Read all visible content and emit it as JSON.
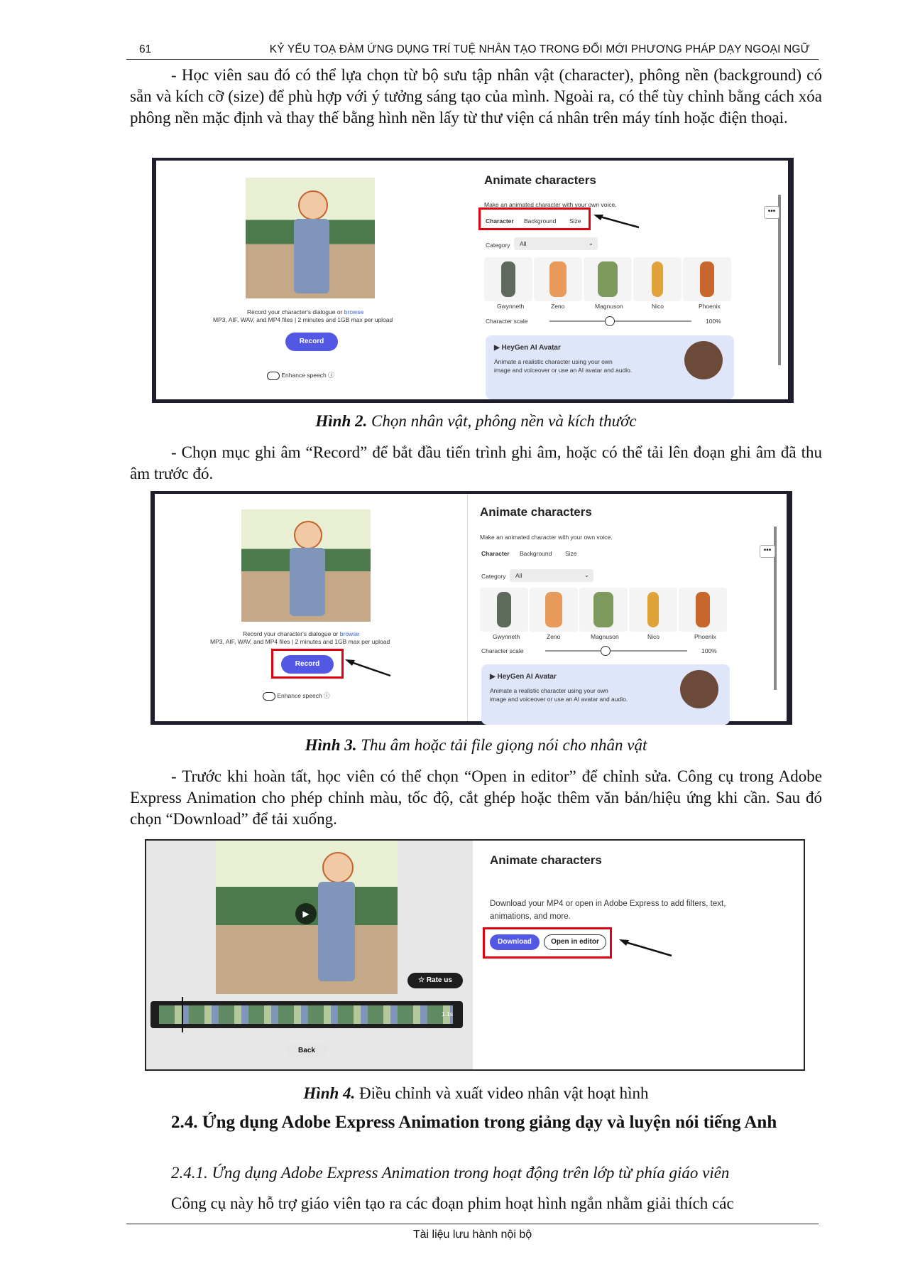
{
  "header": {
    "page_number": "61",
    "title": "KỶ YẾU TOẠ ĐÀM ỨNG DỤNG TRÍ TUỆ NHÂN TẠO TRONG ĐỔI MỚI PHƯƠNG PHÁP DẠY NGOẠI NGỮ"
  },
  "paragraphs": {
    "p1": "- Học viên sau đó có thể lựa chọn từ bộ sưu tập nhân vật (character), phông nền (background) có sẵn và kích cỡ (size) để phù hợp với ý tưởng sáng tạo của mình. Ngoài ra, có thể tùy chỉnh bằng cách xóa phông nền mặc định và thay thế bằng hình nền lấy từ thư viện cá nhân trên máy tính hoặc điện thoại.",
    "p2": "- Chọn mục ghi âm “Record” để bắt đầu tiến trình ghi âm, hoặc có thể tải lên đoạn ghi âm đã thu âm trước đó.",
    "p3": "- Trước khi hoàn tất, học viên có thể chọn “Open in editor” để chỉnh sửa. Công cụ trong Adobe Express Animation cho phép chỉnh màu, tốc độ, cắt ghép hoặc thêm văn bản/hiệu ứng khi cần. Sau đó chọn “Download” để tải xuống.",
    "p4": "Công cụ này hỗ trợ giáo viên tạo ra các đoạn phim hoạt hình ngắn nhằm giải thích các"
  },
  "captions": {
    "fig2_label": "Hình 2.",
    "fig2_text": " Chọn nhân vật, phông nền và kích thước",
    "fig3_label": "Hình 3.",
    "fig3_text": " Thu âm hoặc tải file giọng nói cho nhân vật",
    "fig4_label": "Hình 4.",
    "fig4_text": " Điều chỉnh và xuất video nhân vật hoạt hình"
  },
  "headings": {
    "h24": "2.4. Ứng dụng Adobe Express Animation trong giảng dạy và luyện nói tiếng Anh",
    "h241": "2.4.1. Ứng dụng Adobe Express Animation trong hoạt động trên lớp từ phía giáo viên"
  },
  "footer": {
    "text": "Tài liệu lưu hành nội bộ"
  },
  "ui": {
    "panel_title": "Animate characters",
    "subtitle": "Make an animated character with your own voice.",
    "tabs": [
      "Character",
      "Background",
      "Size"
    ],
    "category_label": "Category",
    "category_value": "All",
    "characters": [
      "Gwynneth",
      "Zeno",
      "Magnuson",
      "Nico",
      "Phoenix"
    ],
    "scale_label": "Character scale",
    "scale_value": "100%",
    "heygen_title": "HeyGen AI Avatar",
    "heygen_desc1": "Animate a realistic character using your own",
    "heygen_desc2": "image and voiceover or use an AI avatar and audio.",
    "record_hint": "Record your character's dialogue or",
    "browse": "browse",
    "file_hint": "MP3, AIF, WAV, and MP4 files | 2 minutes and 1GB max per upload",
    "record_button": "Record",
    "enhance": "Enhance speech",
    "download_text": "Download your MP4 or open in Adobe Express to add filters, text, animations, and more.",
    "download_button": "Download",
    "open_editor_button": "Open in editor",
    "rate_us": "Rate us",
    "back_button": "Back",
    "timeline_time": "1.1s",
    "accent": "#5258e4"
  }
}
